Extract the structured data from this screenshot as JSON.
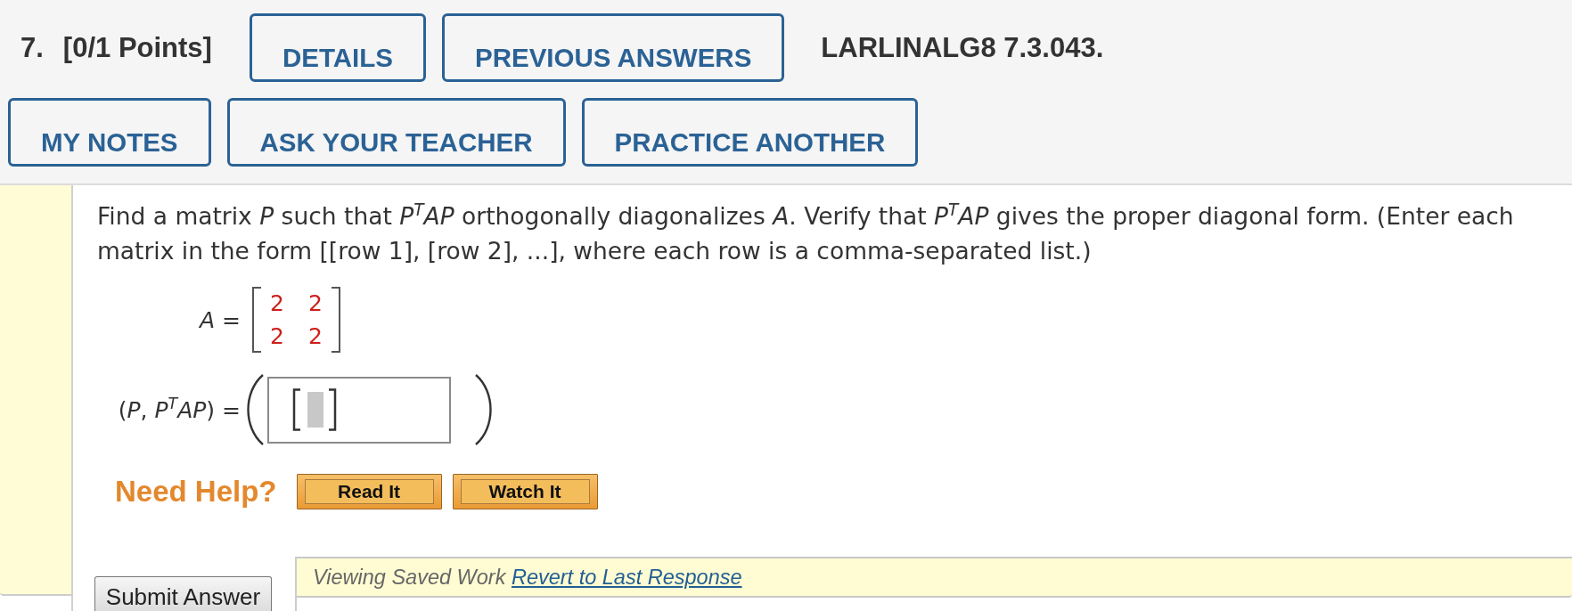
{
  "header": {
    "number": "7.",
    "points": "[0/1 Points]",
    "top_buttons": [
      "DETAILS",
      "PREVIOUS ANSWERS"
    ],
    "problem_id": "LARLINALG8 7.3.043.",
    "bottom_buttons": [
      "MY NOTES",
      "ASK YOUR TEACHER",
      "PRACTICE ANOTHER"
    ]
  },
  "question": {
    "text": "Find a matrix *P* such that *P*$^{T}$*AP* orthogonally diagonalizes *A*. Verify that *P*$^{T}$*AP* gives the proper diagonal form. (Enter each matrix in the form [[row 1], [row 2], ...], where each row is a comma-separated list.)",
    "given": {
      "label": "*A* =",
      "matrix": [
        [
          "2",
          "2"
        ],
        [
          "2",
          "2"
        ]
      ]
    },
    "answer": {
      "label": "(*P*, *P*$^{T}$*AP*) =",
      "field": {
        "kind": "matrix"
      }
    }
  },
  "help": {
    "label": "Need Help?",
    "buttons": [
      "Read It",
      "Watch It"
    ]
  },
  "submit": "Submit Answer",
  "saved_work": {
    "text": "Viewing Saved Work",
    "link": "Revert to Last Response"
  }
}
